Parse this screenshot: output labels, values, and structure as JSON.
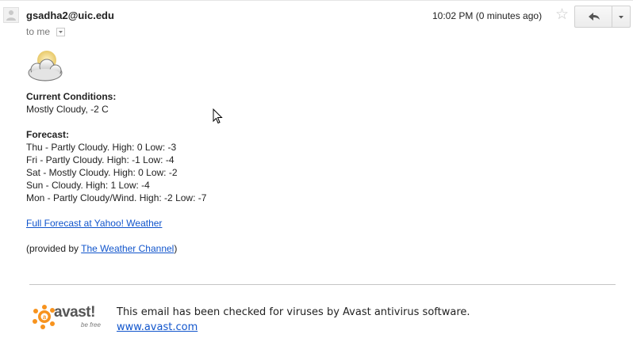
{
  "email": {
    "sender": "gsadha2@uic.edu",
    "to_line": "to me",
    "time": "10:02 PM (0 minutes ago)"
  },
  "icons": {
    "avatar": "person-icon",
    "star": "star-icon",
    "reply": "reply-icon",
    "more": "chevron-down-icon",
    "weather": "cloudy-weather-icon",
    "logo": "avast-logo",
    "cursor": "mouse-cursor"
  },
  "body": {
    "current_heading": "Current Conditions:",
    "current_value": "Mostly Cloudy, -2 C",
    "forecast_heading": "Forecast:",
    "forecast": [
      "Thu - Partly Cloudy. High: 0 Low: -3",
      "Fri - Partly Cloudy. High: -1 Low: -4",
      "Sat - Mostly Cloudy. High: 0 Low: -2",
      "Sun - Cloudy. High: 1 Low: -4",
      "Mon - Partly Cloudy/Wind. High: -2 Low: -7"
    ],
    "full_forecast_link": "Full Forecast at Yahoo! Weather",
    "provided_prefix": "(provided by ",
    "provided_link": "The Weather Channel",
    "provided_suffix": ")"
  },
  "footer": {
    "logo_text": "avast!",
    "tagline": "be free",
    "message": "This email has been checked for viruses by Avast antivirus software.",
    "link": "www.avast.com"
  },
  "colors": {
    "link": "#1155cc",
    "avast_orange": "#f7931e"
  }
}
